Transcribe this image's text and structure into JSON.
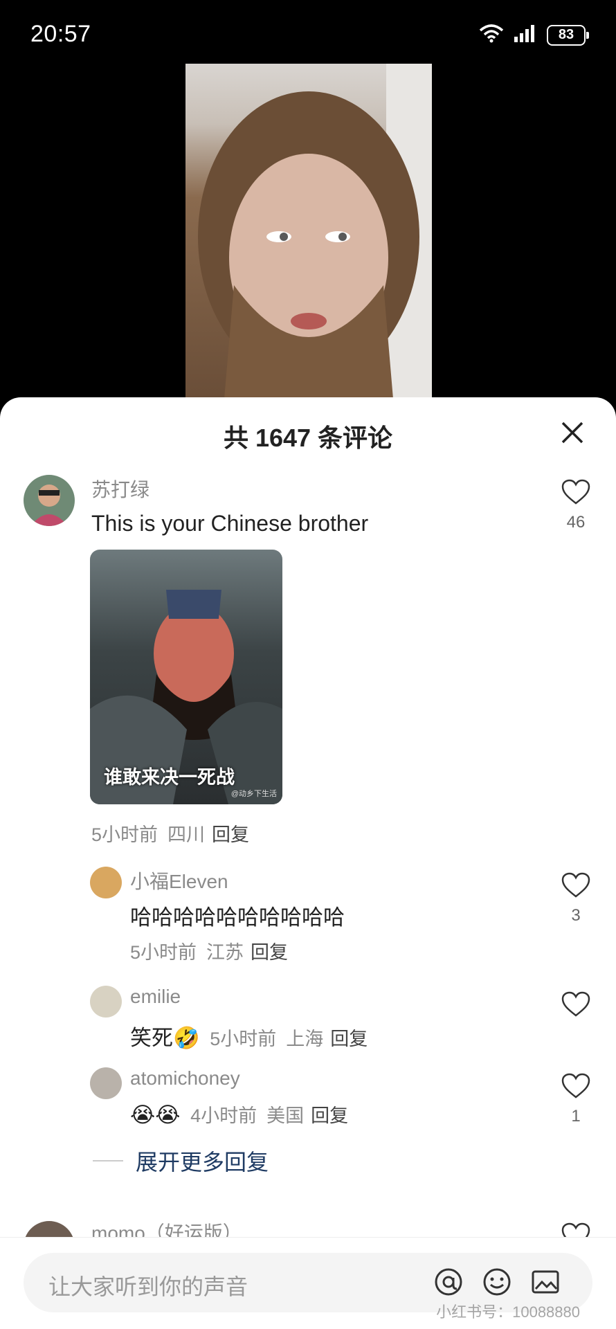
{
  "status_bar": {
    "time": "20:57",
    "battery": "83"
  },
  "sheet": {
    "title": "共 1647 条评论"
  },
  "comments": {
    "main": {
      "username": "苏打绿",
      "text": "This is your Chinese brother",
      "likes": "46",
      "meme_caption": "谁敢来决一死战",
      "meme_mark": "@动乡下生活",
      "time": "5小时前",
      "location": "四川",
      "reply": "回复"
    },
    "r1": {
      "username": "小福Eleven",
      "text": "哈哈哈哈哈哈哈哈哈哈",
      "likes": "3",
      "time": "5小时前",
      "location": "江苏",
      "reply": "回复"
    },
    "r2": {
      "username": "emilie",
      "text": "笑死🤣",
      "time": "5小时前",
      "location": "上海",
      "reply": "回复"
    },
    "r3": {
      "username": "atomichoney",
      "text": "😭😭",
      "likes": "1",
      "time": "4小时前",
      "location": "美国",
      "reply": "回复"
    },
    "expand": "展开更多回复",
    "next": {
      "username": "momo（好运版）"
    }
  },
  "input": {
    "placeholder": "让大家听到你的声音",
    "mention_icon": "at-icon",
    "emoji_icon": "emoji-icon",
    "image_icon": "image-icon"
  },
  "watermark": "小红书号：10088880",
  "colors": {
    "accent_dark_blue": "#1f3b63",
    "meta_gray": "#8a8a8a"
  }
}
